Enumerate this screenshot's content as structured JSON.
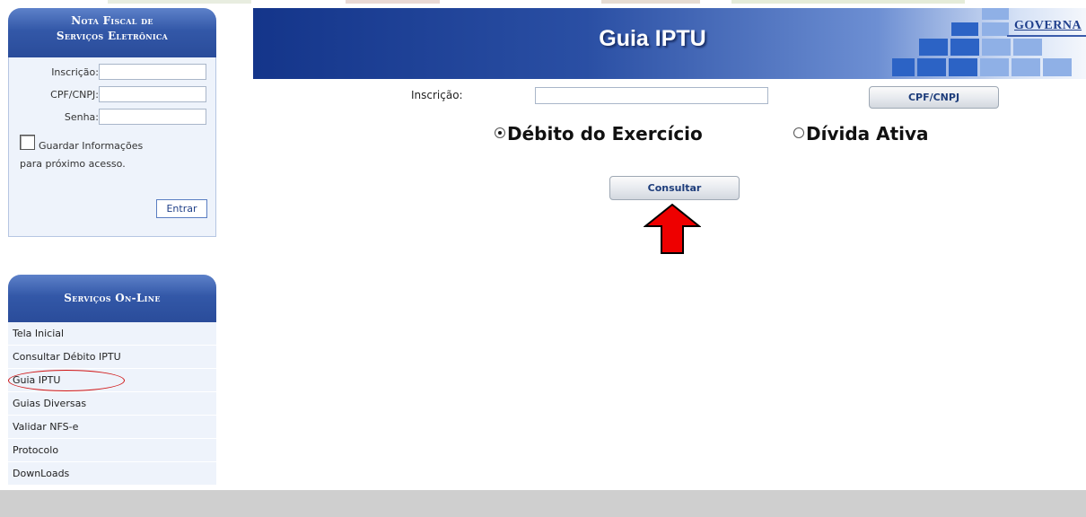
{
  "sidebar": {
    "login": {
      "title_line1": "Nota Fiscal de",
      "title_line2": "Serviços Eletrônica",
      "inscricao_label": "Inscrição:",
      "cpf_label": "CPF/CNPJ:",
      "senha_label": "Senha:",
      "remember_line1": "Guardar Informações",
      "remember_line2": "para próximo acesso.",
      "remember_checked": false,
      "enter_button": "Entrar"
    },
    "services": {
      "title": "Serviços On-Line",
      "items": [
        {
          "label": "Tela Inicial"
        },
        {
          "label": "Consultar Débito IPTU"
        },
        {
          "label": "Guia IPTU"
        },
        {
          "label": "Guias Diversas"
        },
        {
          "label": "Validar NFS-e"
        },
        {
          "label": "Protocolo"
        },
        {
          "label": "DownLoads"
        }
      ],
      "highlighted_item": "Guia IPTU",
      "highlight_color": "#d01515"
    }
  },
  "banner": {
    "title": "Guia IPTU",
    "logo_text": "GOVERNA"
  },
  "form": {
    "inscricao_label": "Inscrição:",
    "inscricao_value": "",
    "cpf_button": "CPF/CNPJ",
    "options": [
      {
        "label": "Débito do Exercício",
        "selected": true
      },
      {
        "label": "Dívida Ativa",
        "selected": false
      }
    ],
    "consultar_button": "Consultar"
  },
  "annotation": {
    "arrow_icon": "red-up-arrow-icon",
    "arrow_color": "#ee0000"
  },
  "colors": {
    "panel_blue": "#3358a8",
    "menu_bg": "#eef3fb",
    "footer_gray": "#cfcfcf"
  }
}
